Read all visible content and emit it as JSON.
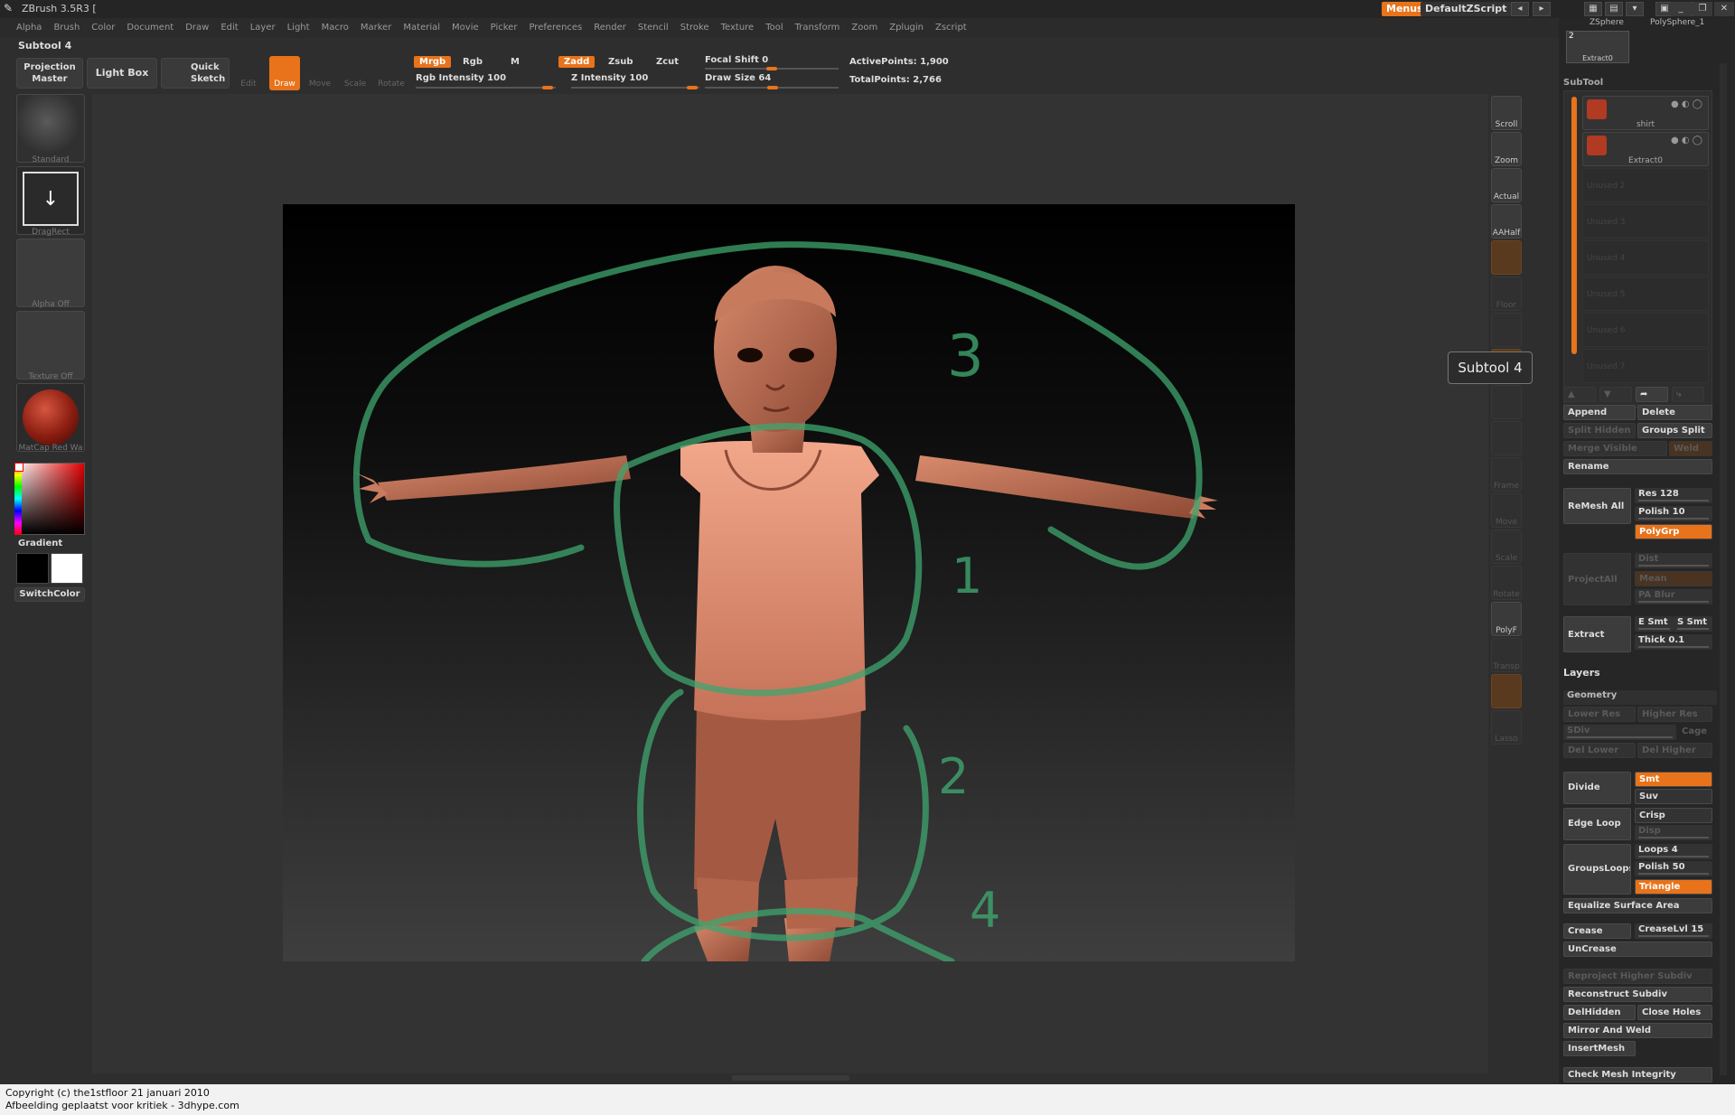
{
  "app": {
    "title": "ZBrush 3.5R3 ["
  },
  "menubar": [
    "Alpha",
    "Brush",
    "Color",
    "Document",
    "Draw",
    "Edit",
    "Layer",
    "Light",
    "Macro",
    "Marker",
    "Material",
    "Movie",
    "Picker",
    "Preferences",
    "Render",
    "Stencil",
    "Stroke",
    "Texture",
    "Tool",
    "Transform",
    "Zoom",
    "Zplugin",
    "Zscript"
  ],
  "topright": {
    "menus": "Menus",
    "script": "DefaultZScript"
  },
  "toolbar": {
    "subtool_title": "Subtool 4",
    "projection_master": "Projection Master",
    "light_box": "Light Box",
    "quick_sketch": "Quick Sketch",
    "edit": "Edit",
    "draw": "Draw",
    "move": "Move",
    "scale": "Scale",
    "rotate": "Rotate",
    "mrgb": "Mrgb",
    "rgb": "Rgb",
    "m": "M",
    "zadd": "Zadd",
    "zsub": "Zsub",
    "zcut": "Zcut",
    "rgb_intensity": "Rgb Intensity 100",
    "z_intensity": "Z Intensity 100",
    "focal_shift": "Focal Shift 0",
    "draw_size": "Draw Size 64",
    "active_points": "ActivePoints: 1,900",
    "total_points": "TotalPoints: 2,766"
  },
  "leftshelf": {
    "brush": "Standard",
    "stroke": "DragRect",
    "alpha": "Alpha Off",
    "texture": "Texture Off",
    "material": "MatCap Red Wa",
    "gradient": "Gradient",
    "switch_color": "SwitchColor"
  },
  "rightshelf": [
    "Scroll",
    "Zoom",
    "Actual",
    "AAHalf",
    "",
    "Floor",
    "",
    "",
    "",
    "",
    "Frame",
    "Move",
    "Scale",
    "Rotate",
    "PolyF",
    "Transp",
    "",
    "Lasso"
  ],
  "annotations": [
    "3",
    "1",
    "2",
    "4"
  ],
  "tooltip": "Subtool 4",
  "panel": {
    "top_tools": {
      "zsphere": "ZSphere",
      "polysphere": "PolySphere_1",
      "extract": "Extract0",
      "count": "2"
    },
    "subtool_header": "SubTool",
    "subtools": [
      "shirt",
      "Extract0",
      "Unused 2",
      "Unused 3",
      "Unused 4",
      "Unused 5",
      "Unused 6",
      "Unused 7"
    ],
    "append": "Append",
    "delete": "Delete",
    "split_hidden": "Split Hidden",
    "groups_split": "Groups Split",
    "merge_visible": "Merge Visible",
    "weld": "Weld",
    "rename": "Rename",
    "remesh_all": "ReMesh All",
    "res": "Res 128",
    "polish": "Polish 10",
    "polygrp": "PolyGrp",
    "project_all": "ProjectAll",
    "dist": "Dist",
    "mean": "Mean",
    "pa_blur": "PA Blur",
    "extract": "Extract",
    "e_smt": "E Smt",
    "s_smt": "S Smt",
    "thick": "Thick 0.1",
    "layers": "Layers",
    "geometry": "Geometry",
    "lower_res": "Lower Res",
    "higher_res": "Higher Res",
    "sdiv": "SDiv",
    "cage": "Cage",
    "del_lower": "Del Lower",
    "del_higher": "Del Higher",
    "divide": "Divide",
    "smt": "Smt",
    "suv": "Suv",
    "edge_loop": "Edge Loop",
    "crisp": "Crisp",
    "disp": "Disp",
    "groups_loops": "GroupsLoops",
    "loops": "Loops 4",
    "polish50": "Polish 50",
    "triangle": "Triangle",
    "equalize": "Equalize Surface Area",
    "crease": "Crease",
    "crease_lvl": "CreaseLvl 15",
    "uncrease": "UnCrease",
    "reproject": "Reproject Higher Subdiv",
    "reconstruct": "Reconstruct Subdiv",
    "delhidden": "DelHidden",
    "close_holes": "Close Holes",
    "mirror_weld": "Mirror And Weld",
    "insertmesh": "InsertMesh",
    "check_mesh": "Check Mesh Integrity"
  },
  "footer": {
    "line1": "Copyright (c) the1stfloor 21 januari 2010",
    "line2": "Afbeelding geplaatst voor kritiek - 3dhype.com"
  },
  "colors": {
    "accent": "#e8731b",
    "annotation": "#3fa56f",
    "figure": "#b8654a"
  }
}
